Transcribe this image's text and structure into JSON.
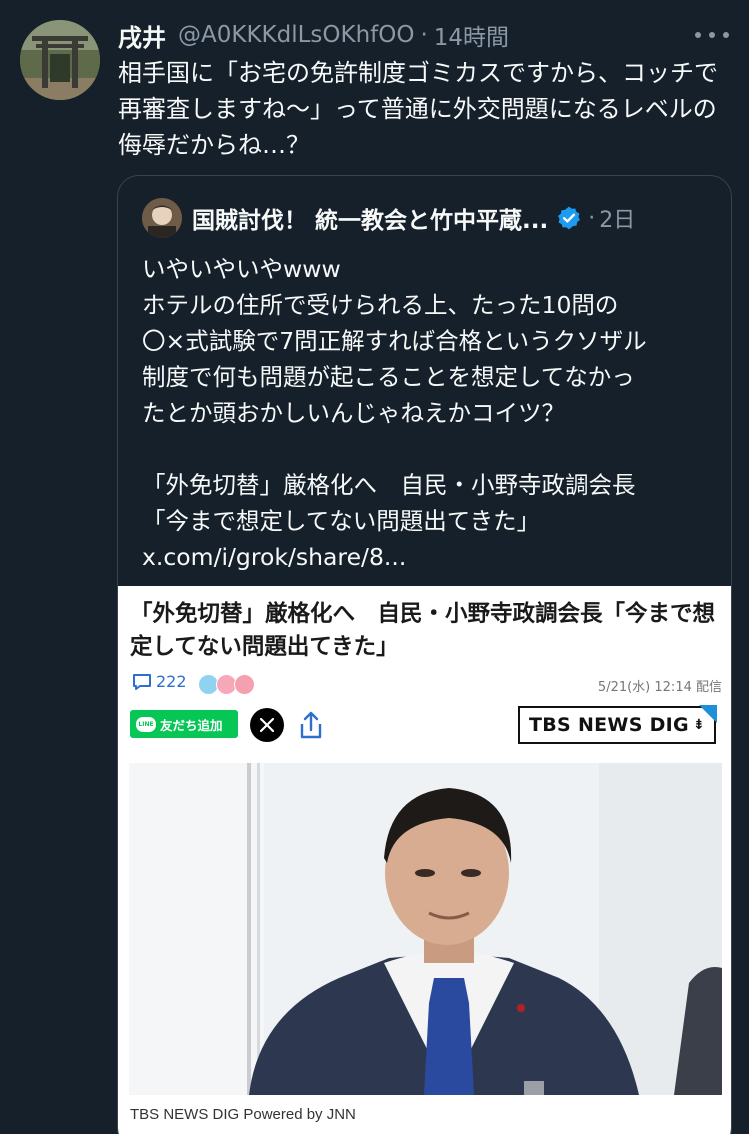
{
  "tweet": {
    "display_name": "戌井",
    "handle": "@A0KKKdlLsOKhfOO",
    "separator": "·",
    "time": "14時間",
    "avatar_icon": "shrine-torii-avatar",
    "more_icon": "more-dots-icon",
    "text": "相手国に「お宅の免許制度ゴミカスですから、コッチで再審査しますね〜」って普通に外交問題になるレベルの侮辱だからね…？"
  },
  "quote": {
    "display_name": "国賊討伐！ 統一教会と竹中平蔵...",
    "separator": "·",
    "time": "2日",
    "verified_icon": "verified-badge-icon",
    "lines": [
      "いやいやいやwww",
      "ホテルの住所で受けられる上、たった10問の",
      "〇×式試験で7問正解すれば合格というクソザル",
      "制度で何も問題が起こることを想定してなかっ",
      "たとか頭おかしいんじゃねえかコイツ？",
      "",
      "「外免切替」厳格化へ　自民・小野寺政調会長",
      "「今まで想定してない問題出てきた」",
      "x.com/i/grok/share/8..."
    ]
  },
  "article": {
    "headline": "「外免切替」厳格化へ　自民・小野寺政調会長「今まで想定してない問題出てきた」",
    "comment_count": "222",
    "date": "5/21(水) 12:14 配信",
    "line_button": "友だち追加",
    "line_logo_text": "LINE",
    "brand": "TBS NEWS DIG",
    "caption": "TBS NEWS DIG Powered by JNN",
    "colors": {
      "line_green": "#06c755",
      "comment_blue": "#2d6fd0",
      "tbs_blue": "#1f8fd6"
    }
  }
}
